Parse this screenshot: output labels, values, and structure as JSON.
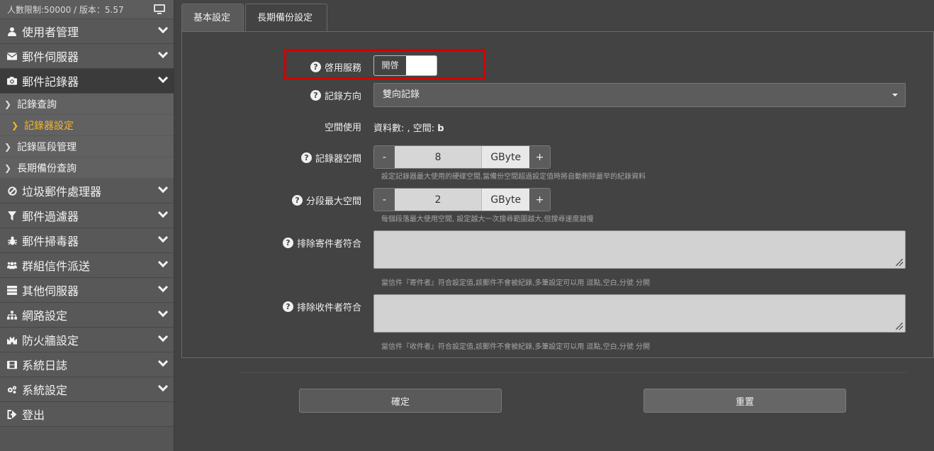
{
  "sidebar": {
    "top_info": "人數限制:50000 / 版本：5.57",
    "items": [
      {
        "label": "使用者管理",
        "icon": "user-icon"
      },
      {
        "label": "郵件伺服器",
        "icon": "envelope-icon"
      },
      {
        "label": "郵件記錄器",
        "icon": "camera-icon"
      },
      {
        "label": "垃圾郵件處理器",
        "icon": "ban-icon"
      },
      {
        "label": "郵件過濾器",
        "icon": "filter-icon"
      },
      {
        "label": "郵件掃毒器",
        "icon": "bug-icon"
      },
      {
        "label": "群組信件派送",
        "icon": "users-icon"
      },
      {
        "label": "其他伺服器",
        "icon": "server-icon"
      },
      {
        "label": "網路設定",
        "icon": "sitemap-icon"
      },
      {
        "label": "防火牆設定",
        "icon": "castle-icon"
      },
      {
        "label": "系統日誌",
        "icon": "film-icon"
      },
      {
        "label": "系統設定",
        "icon": "gears-icon"
      },
      {
        "label": "登出",
        "icon": "signout-icon"
      }
    ],
    "sub_items": [
      "記錄查詢",
      "記錄器設定",
      "記錄區段管理",
      "長期備份查詢"
    ]
  },
  "tabs": {
    "basic": "基本設定",
    "backup": "長期備份設定"
  },
  "form": {
    "enable_label": "啓用服務",
    "toggle_on": "開啓",
    "direction_label": "記錄方向",
    "direction_value": "雙向記錄",
    "usage_label": "空間使用",
    "usage_value": "資料數: , 空間: ",
    "usage_unit": "b",
    "recorder_space_label": "記錄器空間",
    "recorder_space_value": "8",
    "unit": "GByte",
    "minus": "-",
    "plus": "+",
    "recorder_space_hint": "設定記錄器最大使用的硬碟空間,當備份空間超過設定值時將自動刪除最早的紀錄資料",
    "segment_label": "分段最大空間",
    "segment_value": "2",
    "segment_hint": "每個段落最大使用空間, 設定越大一次搜尋範圍越大,但搜尋速度越慢",
    "exclude_sender_label": "排除寄件者符合",
    "exclude_sender_hint": "當信件『寄件者』符合設定值,該郵件不會被紀錄,多筆設定可以用 逗點,空白,分號 分開",
    "exclude_recipient_label": "排除收件者符合",
    "exclude_recipient_hint": "當信件『收件者』符合設定值,該郵件不會被紀錄,多筆設定可以用 逗點,空白,分號 分開"
  },
  "buttons": {
    "confirm": "確定",
    "reset": "重置"
  },
  "colors": {
    "highlight": "#d40000",
    "current_sub": "#f5b62a"
  }
}
